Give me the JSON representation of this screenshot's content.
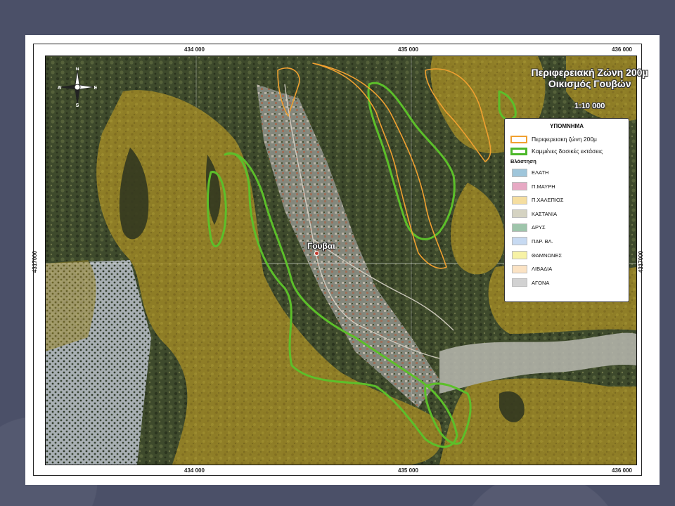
{
  "map": {
    "title_line1": "Περιφερειακή Ζώνη 200μ",
    "title_line2": "Οικισμός Γουβών",
    "scale": "1:10 000",
    "place_label": "Γουβαι",
    "ticks_x": [
      "434 000",
      "435 000",
      "436 000"
    ],
    "ticks_y": [
      "4317000"
    ],
    "compass": {
      "n": "N",
      "s": "S",
      "e": "E",
      "w": "W",
      "icon": "compass-rose-icon"
    }
  },
  "legend": {
    "title": "ΥΠΟΜΝΗΜΑ",
    "zone_label": "Περιφερειακη ζώνη 200μ",
    "burnt_label": "Καμμένες δασικές εκτάσεις",
    "zone_color": "#f0a030",
    "burnt_color": "#4cb82a",
    "vegetation_heading": "Βλάστηση",
    "vegetation": [
      {
        "label": "ΕΛΑΤΗ",
        "color": "#9fc6db"
      },
      {
        "label": "Π.ΜΑΥΡΗ",
        "color": "#e7a9c4"
      },
      {
        "label": "Π.ΧΑΛΕΠΙΟΣ",
        "color": "#f5dea0"
      },
      {
        "label": "ΚΑΣΤΑΝΙΑ",
        "color": "#d5d3c2"
      },
      {
        "label": "ΔΡΥΣ",
        "color": "#9ec5ab"
      },
      {
        "label": "ΠΑΡ. ΒΛ.",
        "color": "#c7daf2"
      },
      {
        "label": "ΘΑΜΝΩΝΕΣ",
        "color": "#f7f2a5"
      },
      {
        "label": "ΛΙΒΑΔΙΑ",
        "color": "#fbe3c4"
      },
      {
        "label": "ΑΓΟΝΑ",
        "color": "#d2d2d2"
      }
    ]
  }
}
